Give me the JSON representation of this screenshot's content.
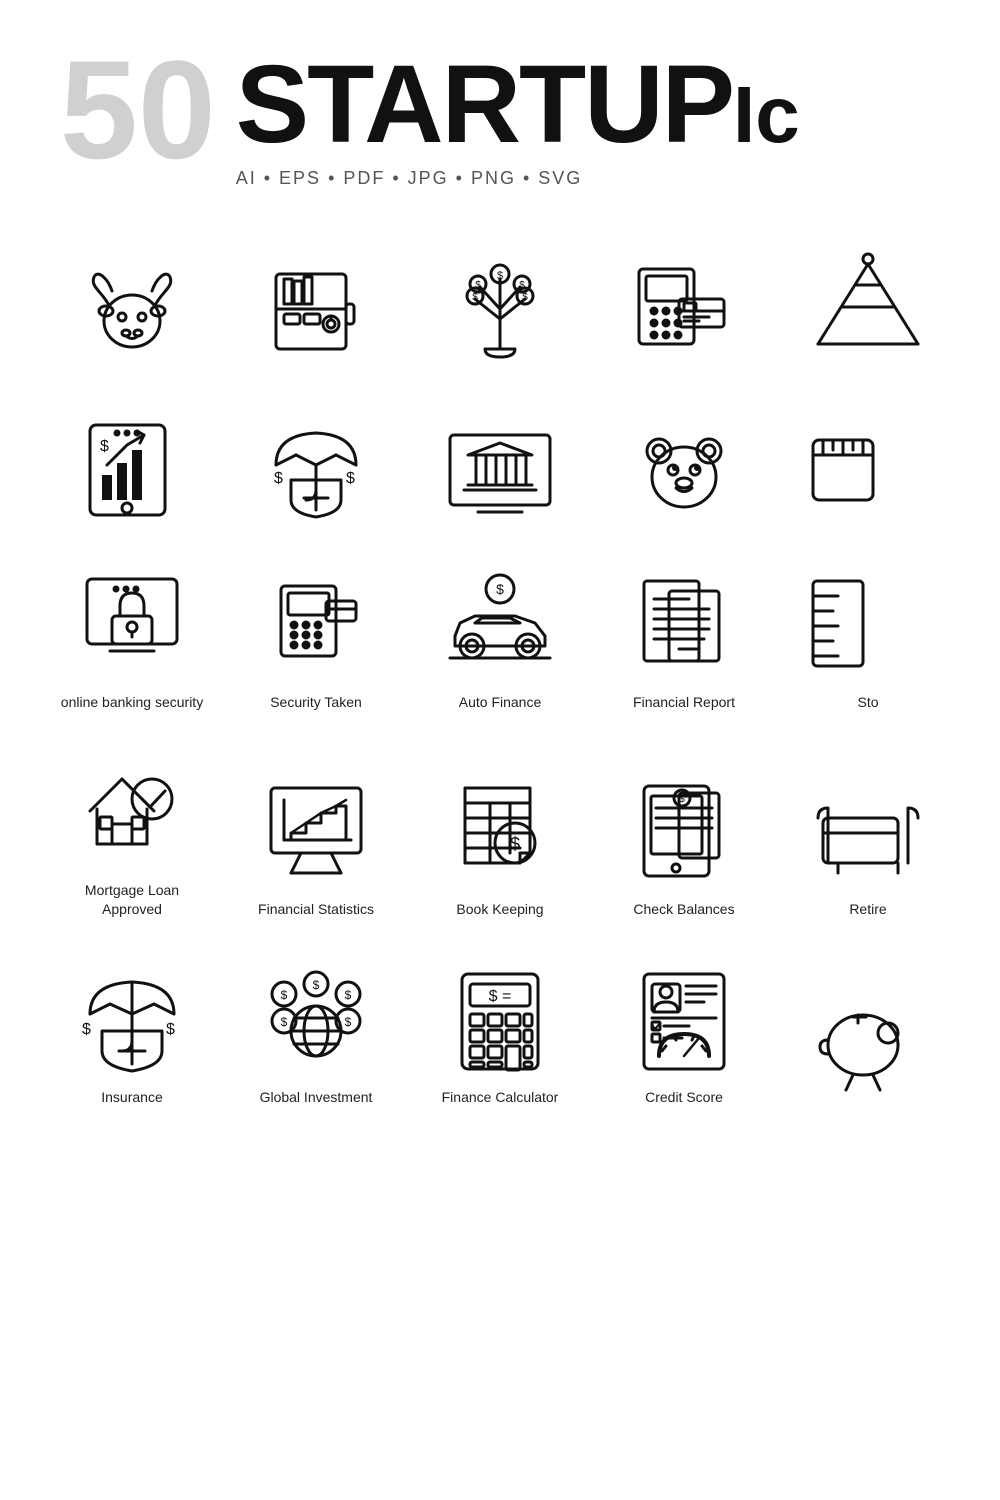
{
  "header": {
    "number": "50",
    "title": "STARTUP",
    "title_suffix": "Ic",
    "subtitle": "AI  •  EPS  •  PDF  •  JPG  •  PNG  •  SVG"
  },
  "icons": {
    "row1": [
      {
        "name": "bull-head-icon",
        "label": "",
        "id": "bull"
      },
      {
        "name": "vault-icon",
        "label": "",
        "id": "vault"
      },
      {
        "name": "money-tree-icon",
        "label": "",
        "id": "money-tree"
      },
      {
        "name": "pos-terminal-icon",
        "label": "",
        "id": "pos"
      },
      {
        "name": "pyramid-icon",
        "label": "",
        "id": "pyramid",
        "partial": true
      }
    ],
    "row2": [
      {
        "name": "tablet-finance-icon",
        "label": "",
        "id": "tablet"
      },
      {
        "name": "insurance-shield-icon",
        "label": "",
        "id": "insurance-shield"
      },
      {
        "name": "bank-building-icon",
        "label": "",
        "id": "bank"
      },
      {
        "name": "bear-head-icon",
        "label": "",
        "id": "bear"
      },
      {
        "name": "partial-icon",
        "label": "",
        "id": "partial2",
        "partial": true
      }
    ],
    "row3": [
      {
        "name": "online-banking-security-icon",
        "label": "online banking security",
        "id": "obs"
      },
      {
        "name": "security-taken-icon",
        "label": "Security Taken",
        "id": "st"
      },
      {
        "name": "auto-finance-icon",
        "label": "Auto Finance",
        "id": "af"
      },
      {
        "name": "financial-report-icon",
        "label": "Financial Report",
        "id": "fr"
      },
      {
        "name": "stock-icon",
        "label": "Sto",
        "id": "stock",
        "partial": true
      }
    ],
    "row4": [
      {
        "name": "mortgage-loan-icon",
        "label": "Mortgage Loan\nApproved",
        "id": "ml"
      },
      {
        "name": "financial-statistics-icon",
        "label": "Financial Statistics",
        "id": "fs"
      },
      {
        "name": "book-keeping-icon",
        "label": "Book Keeping",
        "id": "bk"
      },
      {
        "name": "check-balances-icon",
        "label": "Check Balances",
        "id": "cb"
      },
      {
        "name": "retirement-icon",
        "label": "Retire",
        "id": "retire",
        "partial": true
      }
    ],
    "row5": [
      {
        "name": "insurance-icon",
        "label": "Insurance",
        "id": "ins"
      },
      {
        "name": "global-investment-icon",
        "label": "Global Investment",
        "id": "gi"
      },
      {
        "name": "finance-calculator-icon",
        "label": "Finance Calculator",
        "id": "fc"
      },
      {
        "name": "credit-score-icon",
        "label": "Credit Score",
        "id": "cs"
      },
      {
        "name": "partial5-icon",
        "label": "",
        "id": "partial5",
        "partial": true
      }
    ]
  }
}
